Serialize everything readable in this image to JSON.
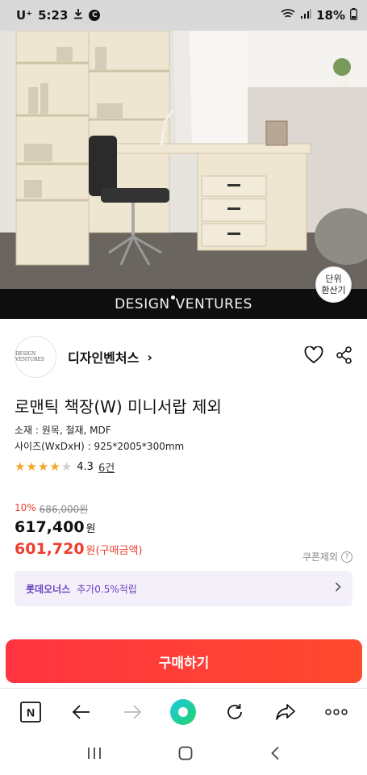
{
  "status_bar": {
    "carrier": "U⁺",
    "time": "5:23",
    "battery": "18%",
    "icons": [
      "download-icon",
      "c-icon",
      "wifi-icon",
      "signal-icon",
      "battery-icon"
    ]
  },
  "hero": {
    "brand_left": "DESIGN",
    "brand_right": "VENTURES",
    "unit_button_line1": "단위",
    "unit_button_line2": "환산기"
  },
  "seller": {
    "logo_text": "DESIGN VENTURES",
    "name": "디자인벤처스",
    "arrow": "›"
  },
  "product": {
    "title": "로맨틱 책장(W) 미니서랍 제외",
    "material": "소재 : 원목, 철재, MDF",
    "size": "사이즈(WxDxH) : 925*2005*300mm",
    "rating": 4.3,
    "rating_text": "4.3",
    "review_count": "6건"
  },
  "pricing": {
    "discount_pct": "10%",
    "original_price": "686,000원",
    "price": "617,400",
    "price_unit": "원",
    "buy_price": "601,720",
    "buy_price_unit": "원",
    "buy_price_note": "(구매금액)",
    "coupon_note": "쿠폰제외"
  },
  "membership": {
    "brand": "롯데오너스",
    "benefit": "추가0.5%적립"
  },
  "buy_button": "구매하기",
  "colors": {
    "accent_red": "#ef3e2d",
    "buy_button": "#ff3440",
    "membership_purple": "#6a3fc0",
    "star": "#f5a623"
  },
  "toolbar": {
    "icons": [
      "naver-n-icon",
      "back-arrow-icon",
      "forward-arrow-icon",
      "green-dot-icon",
      "refresh-icon",
      "share-icon",
      "more-icon"
    ],
    "naver_label": "N"
  },
  "android_nav": {
    "icons": [
      "recent-apps-icon",
      "home-icon",
      "back-icon"
    ]
  }
}
